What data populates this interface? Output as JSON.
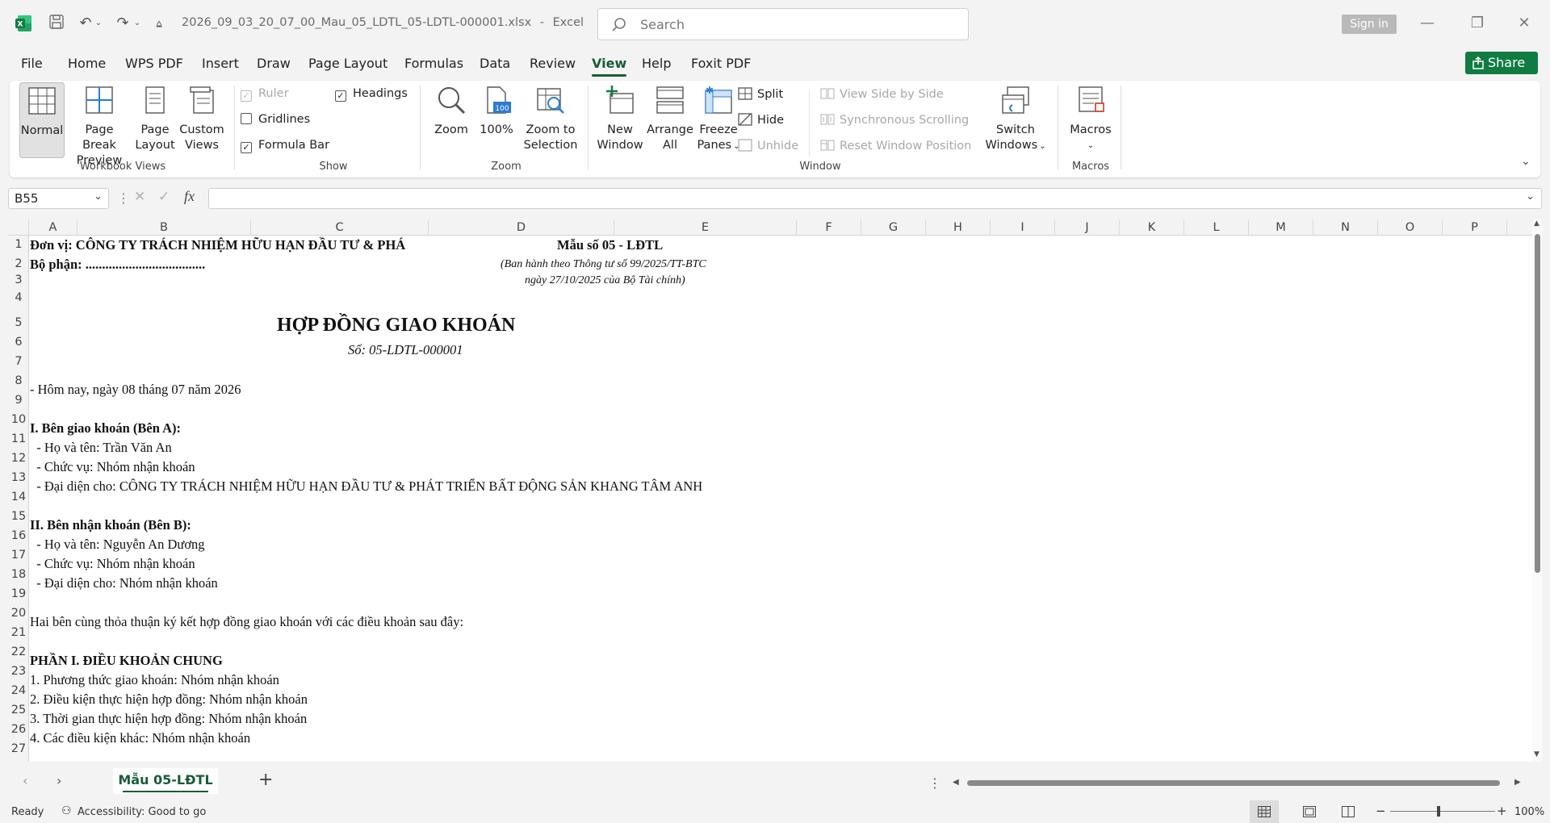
{
  "titlebar": {
    "filename": "2026_09_03_20_07_00_Mau_05_LDTL_05-LDTL-000001.xlsx",
    "app_sep": "-",
    "app": "Excel",
    "search_placeholder": "Search",
    "signin": "Sign in"
  },
  "menu": {
    "tabs": [
      "File",
      "Home",
      "WPS PDF",
      "Insert",
      "Draw",
      "Page Layout",
      "Formulas",
      "Data",
      "Review",
      "View",
      "Help",
      "Foxit PDF"
    ],
    "share": "Share"
  },
  "ribbon": {
    "workbook_views": {
      "label": "Workbook Views",
      "normal": "Normal",
      "page_break_1": "Page Break",
      "page_break_2": "Preview",
      "page_layout_1": "Page",
      "page_layout_2": "Layout",
      "custom_1": "Custom",
      "custom_2": "Views"
    },
    "show": {
      "label": "Show",
      "ruler": "Ruler",
      "headings": "Headings",
      "gridlines": "Gridlines",
      "formula_bar": "Formula Bar"
    },
    "zoom": {
      "label": "Zoom",
      "zoom": "Zoom",
      "hundred": "100%",
      "zoom_sel_1": "Zoom to",
      "zoom_sel_2": "Selection"
    },
    "window": {
      "label": "Window",
      "new_1": "New",
      "new_2": "Window",
      "arrange_1": "Arrange",
      "arrange_2": "All",
      "freeze_1": "Freeze",
      "freeze_2": "Panes",
      "split": "Split",
      "hide": "Hide",
      "unhide": "Unhide",
      "side_by_side": "View Side by Side",
      "sync_scroll": "Synchronous Scrolling",
      "reset_pos": "Reset Window Position",
      "switch_1": "Switch",
      "switch_2": "Windows"
    },
    "macros": {
      "label": "Macros",
      "macros": "Macros"
    }
  },
  "formula": {
    "namebox": "B55",
    "fx": "fx"
  },
  "columns": [
    "A",
    "B",
    "C",
    "D",
    "E",
    "F",
    "G",
    "H",
    "I",
    "J",
    "K",
    "L",
    "M",
    "N",
    "O",
    "P"
  ],
  "rows": [
    "1",
    "2",
    "3",
    "4",
    "5",
    "6",
    "7",
    "8",
    "9",
    "10",
    "11",
    "12",
    "13",
    "14",
    "15",
    "16",
    "17",
    "18",
    "19",
    "20",
    "21",
    "22",
    "23",
    "24",
    "25",
    "26",
    "27"
  ],
  "sheet": {
    "r1_unit": "Đơn vị: CÔNG TY TRÁCH NHIỆM HỮU HẠN ĐẦU TƯ & PHÁ",
    "r1_form": "Mẫu số 05 - LĐTL",
    "r2_dept": "Bộ phận: ....................................",
    "r2_issued": "(Ban hành theo Thông tư số 99/2025/TT-BTC",
    "r3_date": "ngày 27/10/2025 của Bộ Tài chính)",
    "r5_title": "HỢP ĐỒNG GIAO KHOÁN",
    "r6_number": "Số: 05-LDTL-000001",
    "r8_today": "- Hôm nay, ngày 08 tháng 07 năm 2026",
    "r10_party_a": "I. Bên giao khoán (Bên A):",
    "r11": "  - Họ và tên: Trần Văn An",
    "r12": "  - Chức vụ: Nhóm nhận khoán",
    "r13": "  - Đại diện cho: CÔNG TY TRÁCH NHIỆM HỮU HẠN ĐẦU TƯ & PHÁT TRIỂN BẤT ĐỘNG SẢN KHANG TÂM ANH",
    "r15_party_b": "II. Bên nhận khoán (Bên B):",
    "r16": "  - Họ và tên: Nguyễn An Dương",
    "r17": "  - Chức vụ: Nhóm nhận khoán",
    "r18": "  - Đại diện cho: Nhóm nhận khoán",
    "r20": "Hai bên cùng thỏa thuận ký kết hợp đồng giao khoán với các điều khoản sau đây:",
    "r22": "PHẦN I. ĐIỀU KHOẢN CHUNG",
    "r23": "1. Phương thức giao khoán: Nhóm nhận khoán",
    "r24": "2. Điều kiện thực hiện hợp đồng: Nhóm nhận khoán",
    "r25": "3. Thời gian thực hiện hợp đồng: Nhóm nhận khoán",
    "r26": "4. Các điều kiện khác: Nhóm nhận khoán"
  },
  "tabs": {
    "sheet_name": "Mẫu 05-LĐTL",
    "add": "+"
  },
  "status": {
    "ready": "Ready",
    "accessibility": "Accessibility: Good to go",
    "zoom": "100%"
  },
  "colors": {
    "accent": "#185c37",
    "share_bg": "#107c41"
  }
}
